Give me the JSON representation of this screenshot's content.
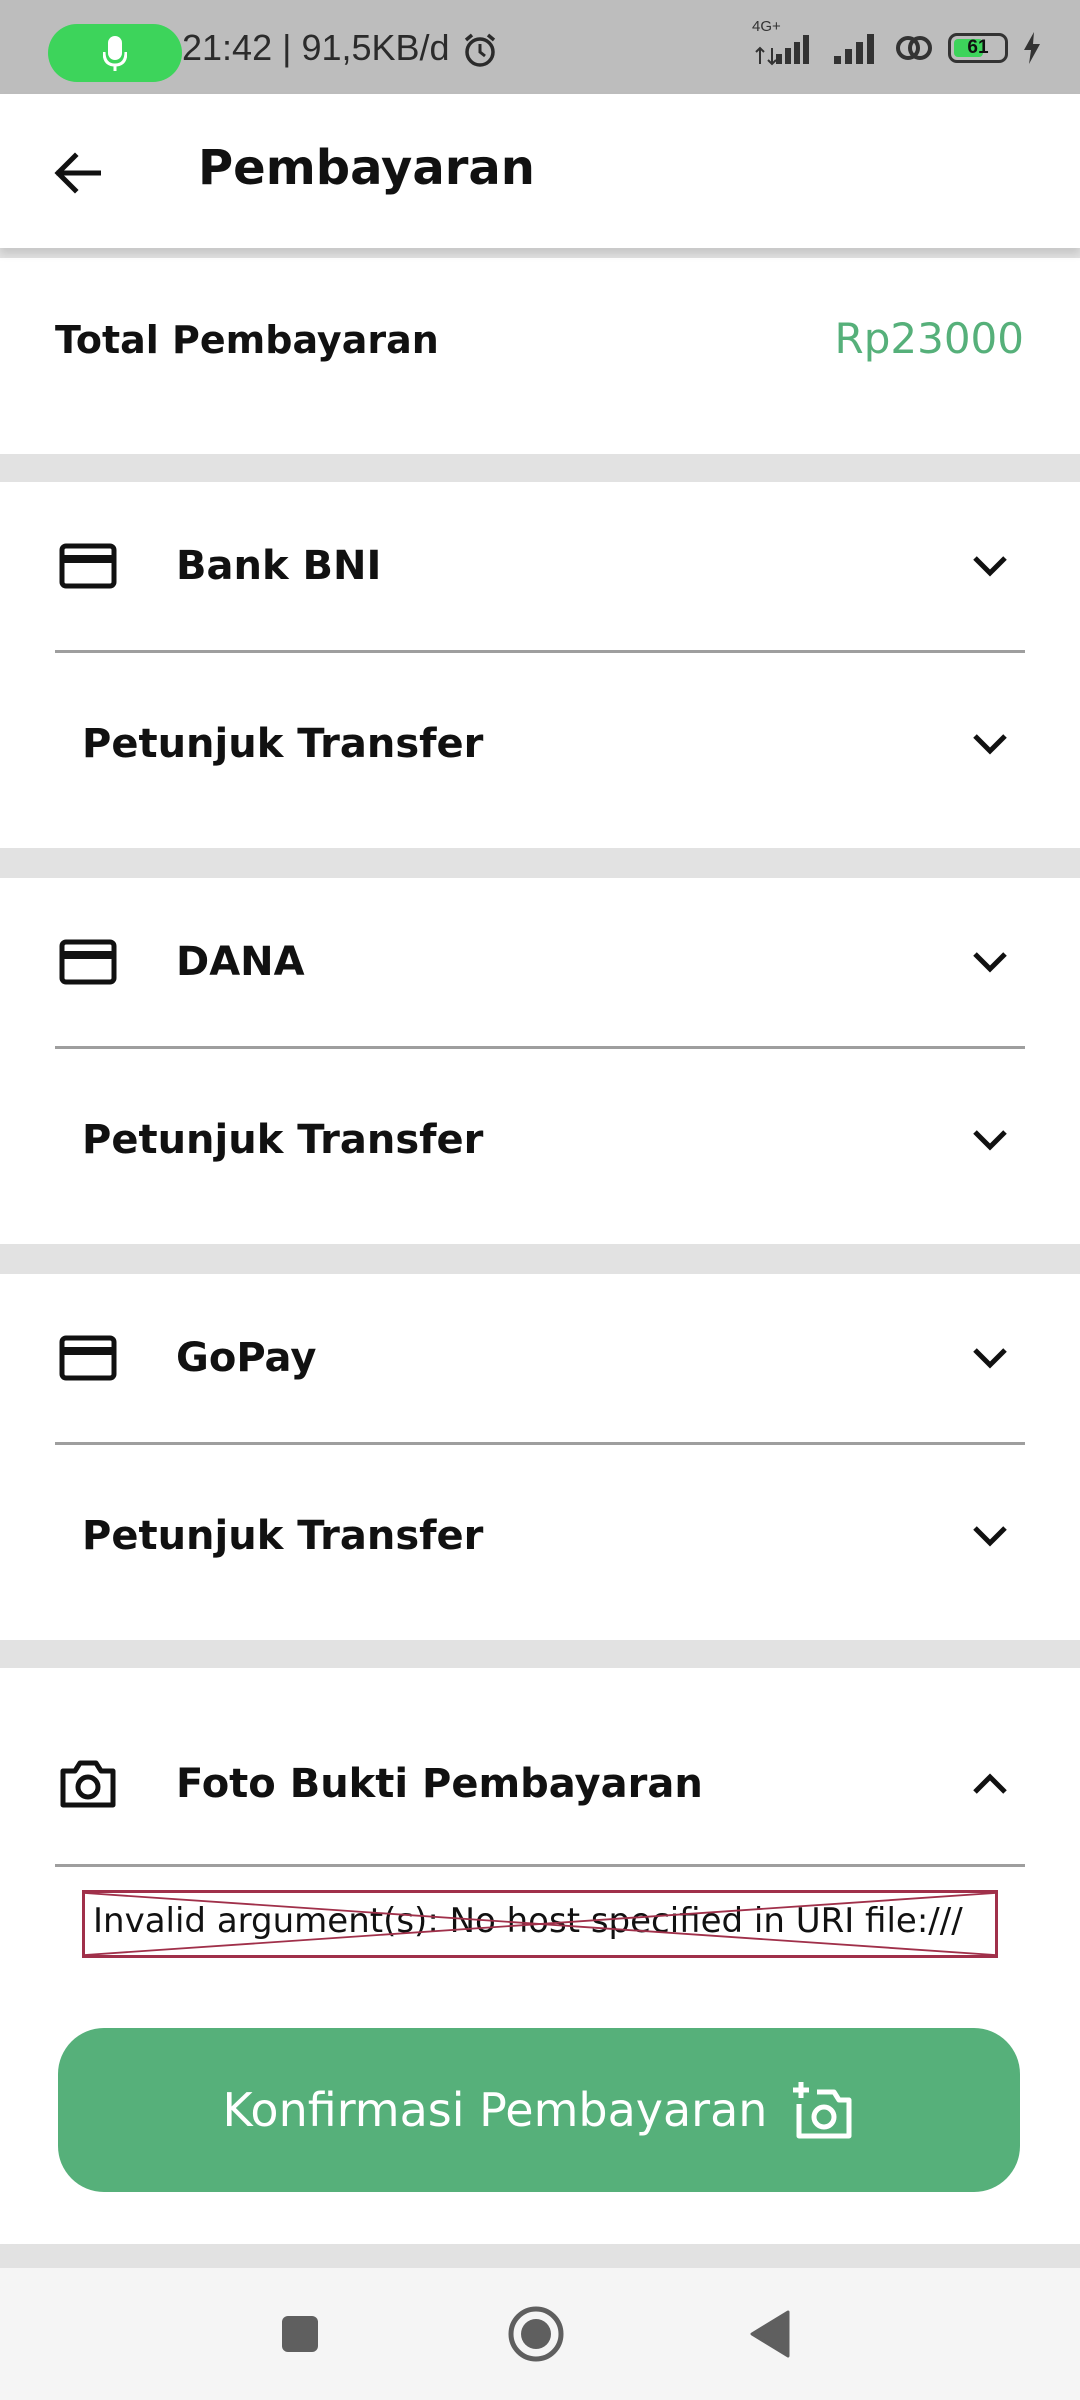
{
  "status_bar": {
    "time_speed": "21:42 | 91,5KB/d",
    "network_label": "4G+",
    "battery": "61",
    "battery_level": 0.61,
    "icons": [
      "mic-icon",
      "alarm-icon",
      "signal-icon",
      "signal-icon",
      "hotspot-icon",
      "battery-icon",
      "charging-icon"
    ]
  },
  "app_bar": {
    "title": "Pembayaran",
    "back_icon": "arrow-left-icon"
  },
  "total": {
    "label": "Total Pembayaran",
    "amount": "Rp23000",
    "amount_color": "#56b07a"
  },
  "payment_methods": [
    {
      "name": "Bank BNI",
      "icon": "credit-card-icon",
      "instructions_label": "Petunjuk Transfer"
    },
    {
      "name": "DANA",
      "icon": "credit-card-icon",
      "instructions_label": "Petunjuk Transfer"
    },
    {
      "name": "GoPay",
      "icon": "credit-card-icon",
      "instructions_label": "Petunjuk Transfer"
    }
  ],
  "proof": {
    "label": "Foto Bukti Pembayaran",
    "icon": "camera-icon",
    "expanded": true,
    "error_text": "Invalid argument(s): No host specified in URI file:///"
  },
  "confirm_button": {
    "label": "Konfirmasi Pembayaran",
    "icon": "add-photo-icon",
    "color": "#56b07a"
  },
  "nav_bar": {
    "icons": [
      "recents-square-icon",
      "home-circle-icon",
      "back-triangle-icon"
    ]
  }
}
